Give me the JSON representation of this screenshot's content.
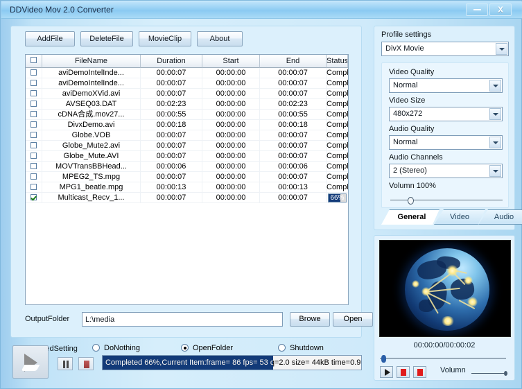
{
  "window": {
    "title": "DDVideo Mov 2.0 Converter",
    "minimize_label": "",
    "close_label": "X"
  },
  "toolbar": {
    "add_file": "AddFile",
    "delete_file": "DeleteFile",
    "movie_clip": "MovieClip",
    "about": "About"
  },
  "grid": {
    "columns": [
      "",
      "FileName",
      "Duration",
      "Start",
      "End",
      "Status"
    ],
    "rows": [
      {
        "checked": false,
        "name": "aviDemoIntelInde...",
        "duration": "00:00:07",
        "start": "00:00:00",
        "end": "00:00:07",
        "status": "Completed",
        "progress": null
      },
      {
        "checked": false,
        "name": "aviDemoIntelInde...",
        "duration": "00:00:07",
        "start": "00:00:00",
        "end": "00:00:07",
        "status": "Completed",
        "progress": null
      },
      {
        "checked": false,
        "name": "aviDemoXVid.avi",
        "duration": "00:00:07",
        "start": "00:00:00",
        "end": "00:00:07",
        "status": "Completed",
        "progress": null
      },
      {
        "checked": false,
        "name": "AVSEQ03.DAT",
        "duration": "00:02:23",
        "start": "00:00:00",
        "end": "00:02:23",
        "status": "Completed",
        "progress": null
      },
      {
        "checked": false,
        "name": "cDNA合成.mov27...",
        "duration": "00:00:55",
        "start": "00:00:00",
        "end": "00:00:55",
        "status": "Completed",
        "progress": null
      },
      {
        "checked": false,
        "name": "DivxDemo.avi",
        "duration": "00:00:18",
        "start": "00:00:00",
        "end": "00:00:18",
        "status": "Completed",
        "progress": null
      },
      {
        "checked": false,
        "name": "Globe.VOB",
        "duration": "00:00:07",
        "start": "00:00:00",
        "end": "00:00:07",
        "status": "Completed",
        "progress": null
      },
      {
        "checked": false,
        "name": "Globe_Mute2.avi",
        "duration": "00:00:07",
        "start": "00:00:00",
        "end": "00:00:07",
        "status": "Completed",
        "progress": null
      },
      {
        "checked": false,
        "name": "Globe_Mute.AVI",
        "duration": "00:00:07",
        "start": "00:00:00",
        "end": "00:00:07",
        "status": "Completed",
        "progress": null
      },
      {
        "checked": false,
        "name": "MOVTransBBHead...",
        "duration": "00:00:06",
        "start": "00:00:00",
        "end": "00:00:06",
        "status": "Completed",
        "progress": null
      },
      {
        "checked": false,
        "name": "MPEG2_TS.mpg",
        "duration": "00:00:07",
        "start": "00:00:00",
        "end": "00:00:07",
        "status": "Completed",
        "progress": null
      },
      {
        "checked": false,
        "name": "MPG1_beatle.mpg",
        "duration": "00:00:13",
        "start": "00:00:00",
        "end": "00:00:13",
        "status": "Completed",
        "progress": null
      },
      {
        "checked": true,
        "name": "Multicast_Recv_1...",
        "duration": "00:00:07",
        "start": "00:00:00",
        "end": "00:00:07",
        "status": "",
        "progress": 66,
        "progress_label": "66%"
      }
    ]
  },
  "output": {
    "label": "OutputFolder",
    "value": "L:\\media",
    "placeholder": "",
    "browse_label": "Browe",
    "open_label": "Open"
  },
  "finished_setting": {
    "label": "FinishedSetting",
    "options": [
      {
        "label": "DoNothing",
        "selected": false
      },
      {
        "label": "OpenFolder",
        "selected": true
      },
      {
        "label": "Shutdown",
        "selected": false
      }
    ]
  },
  "statusbar": {
    "text": "Completed 66%,Current Item:frame=   86 fps= 53 q=2.0 size=      44kB time=0.9",
    "progress": 66,
    "progress_color": "#123a78"
  },
  "profile": {
    "section_label": "Profile settings",
    "selected": "DivX Movie",
    "fields": [
      {
        "label": "Video Quality",
        "value": "Normal"
      },
      {
        "label": "Video Size",
        "value": "480x272"
      },
      {
        "label": "Audio Quality",
        "value": "Normal"
      },
      {
        "label": "Audio Channels",
        "value": "2 (Stereo)"
      }
    ],
    "volume_label": "Volumn 100%",
    "volume_percent": 100
  },
  "tabs": [
    {
      "label": "General",
      "active": true
    },
    {
      "label": "Video",
      "active": false
    },
    {
      "label": "Audio",
      "active": false
    }
  ],
  "preview": {
    "time": "00:00:00/00:00:02",
    "volume_label": "Volumn"
  }
}
